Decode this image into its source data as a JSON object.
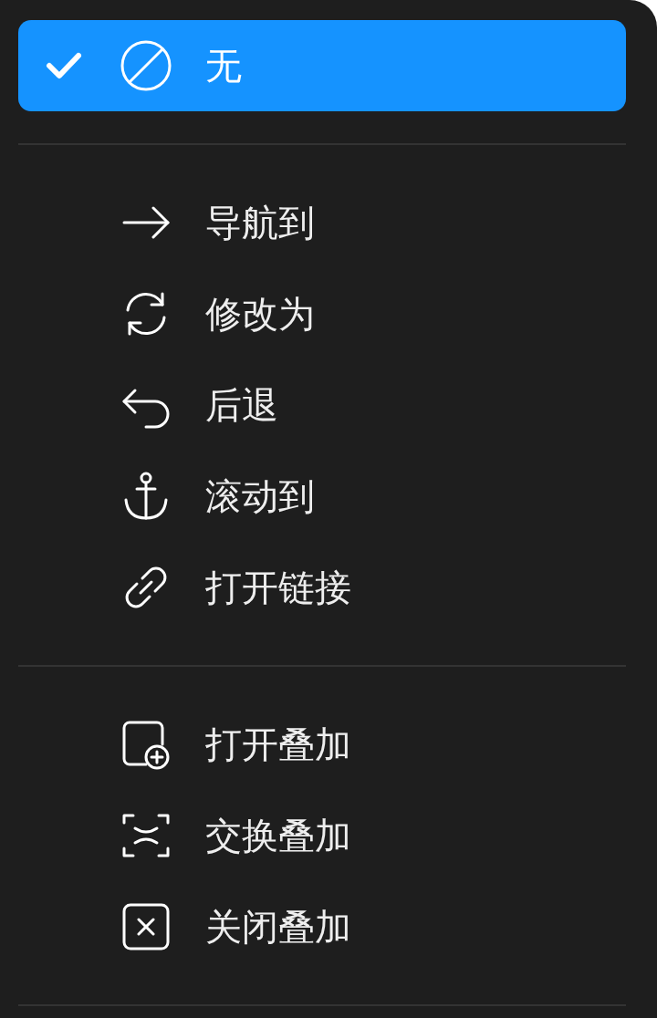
{
  "menu": {
    "sections": [
      {
        "items": [
          {
            "label": "无",
            "selected": true
          }
        ]
      },
      {
        "items": [
          {
            "label": "导航到",
            "selected": false
          },
          {
            "label": "修改为",
            "selected": false
          },
          {
            "label": "后退",
            "selected": false
          },
          {
            "label": "滚动到",
            "selected": false
          },
          {
            "label": "打开链接",
            "selected": false
          }
        ]
      },
      {
        "items": [
          {
            "label": "打开叠加",
            "selected": false
          },
          {
            "label": "交换叠加",
            "selected": false
          },
          {
            "label": "关闭叠加",
            "selected": false
          }
        ]
      }
    ]
  }
}
